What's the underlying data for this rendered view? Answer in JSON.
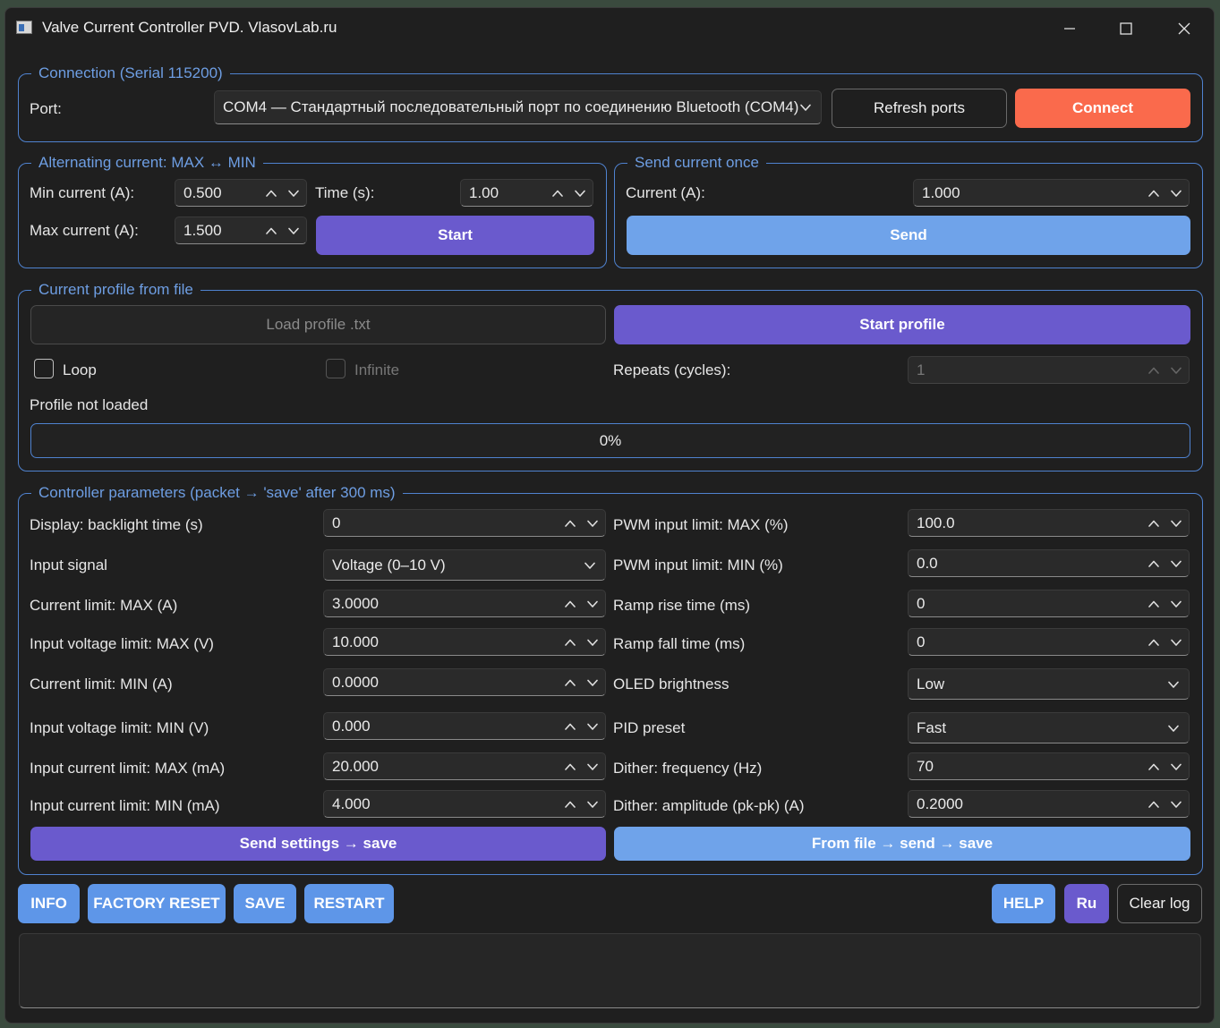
{
  "window": {
    "title": "Valve Current Controller PVD. VlasovLab.ru",
    "controls": [
      "minimize",
      "maximize",
      "close"
    ]
  },
  "connection": {
    "legend": "Connection (Serial 115200)",
    "port_label": "Port:",
    "port_value": "COM4 — Стандартный последовательный порт по соединению Bluetooth (COM4)",
    "refresh_label": "Refresh ports",
    "connect_label": "Connect"
  },
  "alternating": {
    "legend": "Alternating current: MAX ↔ MIN",
    "min_label": "Min current (A):",
    "min_value": "0.500",
    "time_label": "Time (s):",
    "time_value": "1.00",
    "max_label": "Max current (A):",
    "max_value": "1.500",
    "start_label": "Start"
  },
  "send_once": {
    "legend": "Send current once",
    "current_label": "Current (A):",
    "current_value": "1.000",
    "send_label": "Send"
  },
  "profile": {
    "legend": "Current profile from file",
    "load_label": "Load profile .txt",
    "start_label": "Start profile",
    "loop_label": "Loop",
    "loop_checked": false,
    "infinite_label": "Infinite",
    "infinite_checked": false,
    "repeats_label": "Repeats (cycles):",
    "repeats_value": "1",
    "status": "Profile not loaded",
    "progress_percent": 0,
    "progress_text": "0%"
  },
  "params": {
    "legend": "Controller parameters (packet → 'save' after 300 ms)",
    "left": [
      {
        "label": "Display: backlight time (s)",
        "value": "0",
        "kind": "spin"
      },
      {
        "label": "Input signal",
        "value": "Voltage (0–10 V)",
        "kind": "combo"
      },
      {
        "label": "Current limit: MAX (A)",
        "value": "3.0000",
        "kind": "spin"
      },
      {
        "label": "Input voltage limit: MAX (V)",
        "value": "10.000",
        "kind": "spin"
      },
      {
        "label": "Current limit: MIN (A)",
        "value": "0.0000",
        "kind": "spin"
      },
      {
        "label": "Input voltage limit: MIN (V)",
        "value": "0.000",
        "kind": "spin"
      },
      {
        "label": "Input current limit: MAX (mA)",
        "value": "20.000",
        "kind": "spin"
      },
      {
        "label": "Input current limit: MIN (mA)",
        "value": "4.000",
        "kind": "spin"
      }
    ],
    "right": [
      {
        "label": "PWM input limit: MAX (%)",
        "value": "100.0",
        "kind": "spin"
      },
      {
        "label": "PWM input limit: MIN (%)",
        "value": "0.0",
        "kind": "spin"
      },
      {
        "label": "Ramp rise time (ms)",
        "value": "0",
        "kind": "spin"
      },
      {
        "label": "Ramp fall time (ms)",
        "value": "0",
        "kind": "spin"
      },
      {
        "label": "OLED brightness",
        "value": "Low",
        "kind": "combo"
      },
      {
        "label": "PID preset",
        "value": "Fast",
        "kind": "combo"
      },
      {
        "label": "Dither: frequency (Hz)",
        "value": "70",
        "kind": "spin"
      },
      {
        "label": "Dither: amplitude (pk-pk) (A)",
        "value": "0.2000",
        "kind": "spin"
      }
    ],
    "send_settings_label": "Send settings → save",
    "from_file_label": "From file → send → save"
  },
  "bottom": {
    "info_label": "INFO",
    "factory_reset_label": "FACTORY RESET",
    "save_label": "SAVE",
    "restart_label": "RESTART",
    "help_label": "HELP",
    "lang_label": "Ru",
    "clear_log_label": "Clear log"
  },
  "log": {
    "text": ""
  },
  "colors": {
    "accent_blue": "#4f82cf",
    "connect_red": "#fa6a4c",
    "purple": "#6a5acd",
    "light_blue": "#6fa3ea",
    "background": "#1f1f1f"
  }
}
